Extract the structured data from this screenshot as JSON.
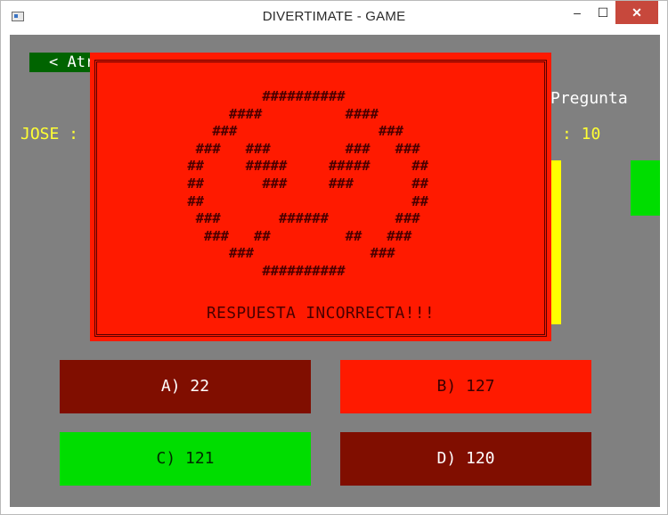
{
  "window": {
    "title": "DIVERTIMATE - GAME",
    "minimize": "–",
    "maximize": "☐",
    "close": "✕"
  },
  "game": {
    "back_label": "< Atrás",
    "player_name": "JOSE :",
    "question_label": "Pregunta",
    "question_number": ": 10"
  },
  "answers": {
    "a": "A) 22",
    "b": "B) 127",
    "c": "C) 121",
    "d": "D) 120"
  },
  "modal": {
    "ascii_art": [
      "          ##########",
      "      ####          ####",
      "    ###                 ###",
      "  ###   ###         ###   ###",
      " ##     #####     #####     ##",
      " ##       ###     ###       ##",
      " ##                         ##",
      "  ###       ######        ###",
      "   ###   ##         ##   ###",
      "      ###              ###",
      "          ##########"
    ],
    "message": "RESPUESTA INCORRECTA!!!"
  },
  "colors": {
    "panel_bg": "#808080",
    "incorrect_red": "#ff1a00",
    "dark_red": "#800e00",
    "correct_green": "#00dd00",
    "highlight_yellow": "#ffff00",
    "back_green": "#006400"
  }
}
